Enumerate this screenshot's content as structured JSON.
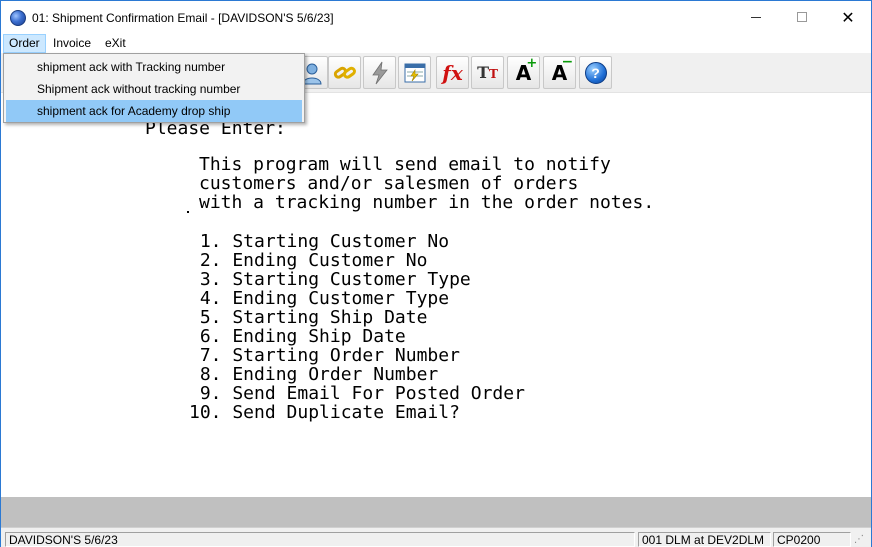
{
  "window": {
    "title": "01: Shipment Confirmation Email - [DAVIDSON'S 5/6/23]",
    "minimize": "",
    "maximize": "",
    "close": "✕"
  },
  "menubar": {
    "items": [
      {
        "label": "Order"
      },
      {
        "label": "Invoice"
      },
      {
        "label": "eXit"
      }
    ]
  },
  "dropdown": {
    "items": [
      {
        "label": "shipment ack with Tracking number"
      },
      {
        "label": "Shipment ack without tracking number"
      },
      {
        "label": "shipment ack for Academy drop ship",
        "highlighted": true
      }
    ]
  },
  "toolbar": {
    "icons": [
      "user-icon",
      "link-icon",
      "lightning-icon",
      "grid-icon",
      "fx-icon",
      "text-size-icon",
      "font-increase-icon",
      "font-decrease-icon",
      "help-icon"
    ],
    "fx": "fx",
    "tt_big": "T",
    "tt_small": "T",
    "a_letter": "A",
    "plus": "+",
    "minus": "−",
    "help": "?"
  },
  "terminal": {
    "prompt": "Please Enter:",
    "description": [
      "This program will send email to notify",
      "customers and/or salesmen of orders",
      "with a tracking number in the order notes."
    ],
    "options": [
      " 1. Starting Customer No",
      " 2. Ending Customer No",
      " 3. Starting Customer Type",
      " 4. Ending Customer Type",
      " 5. Starting Ship Date",
      " 6. Ending Ship Date",
      " 7. Starting Order Number",
      " 8. Ending Order Number",
      " 9. Send Email For Posted Order",
      "10. Send Duplicate Email?"
    ]
  },
  "statusbar": {
    "company": "DAVIDSON'S 5/6/23",
    "user": "001 DLM at DEV2DLM",
    "program": "CP0200"
  },
  "colors": {
    "highlight": "#91c9f7",
    "menu_active": "#cce8ff",
    "band": "#c0c0c0"
  }
}
